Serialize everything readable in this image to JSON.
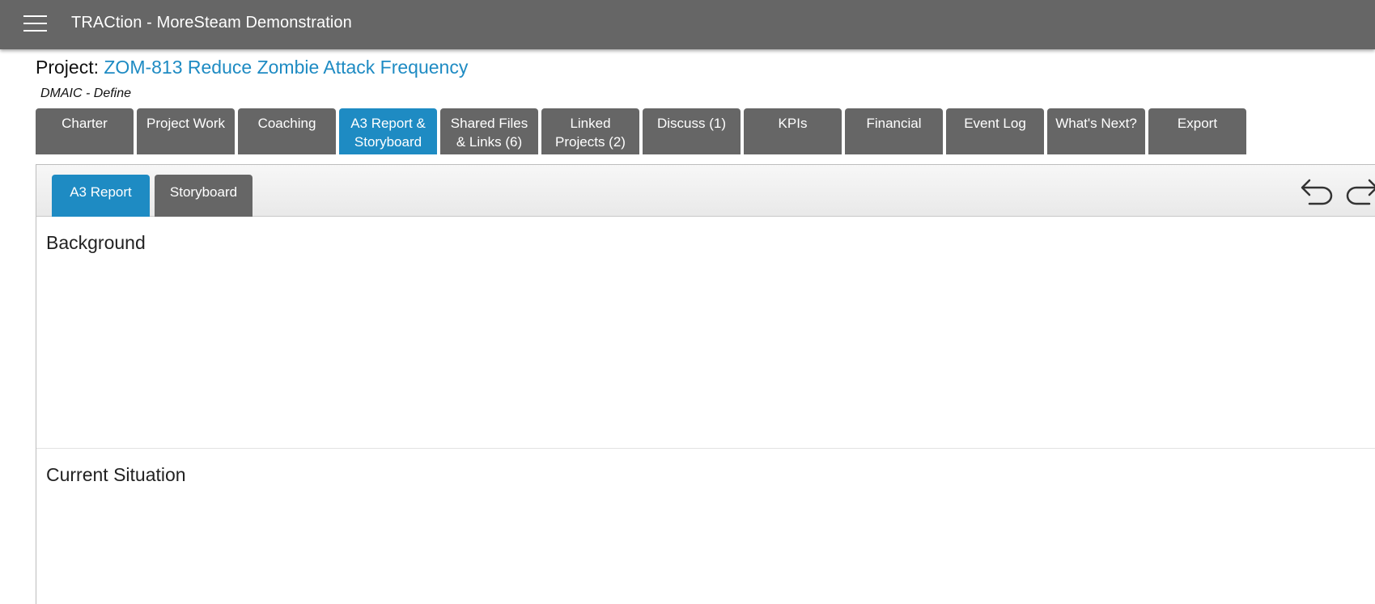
{
  "app": {
    "title": "TRACtion - MoreSteam Demonstration"
  },
  "project": {
    "prefix": "Project:",
    "name": "ZOM-813 Reduce Zombie Attack Frequency",
    "phase": "DMAIC - Define"
  },
  "main_tabs": [
    {
      "line1": "Charter",
      "line2": ""
    },
    {
      "line1": "Project Work",
      "line2": ""
    },
    {
      "line1": "Coaching",
      "line2": ""
    },
    {
      "line1": "A3 Report &",
      "line2": "Storyboard",
      "active": true
    },
    {
      "line1": "Shared Files",
      "line2": "& Links (6)"
    },
    {
      "line1": "Linked",
      "line2": "Projects (2)"
    },
    {
      "line1": "Discuss (1)",
      "line2": ""
    },
    {
      "line1": "KPIs",
      "line2": ""
    },
    {
      "line1": "Financial",
      "line2": ""
    },
    {
      "line1": "Event Log",
      "line2": ""
    },
    {
      "line1": "What's Next?",
      "line2": ""
    },
    {
      "line1": "Export",
      "line2": ""
    }
  ],
  "sub_tabs": [
    {
      "label": "A3 Report",
      "active": true
    },
    {
      "label": "Storyboard"
    }
  ],
  "toolbar": {
    "undo_icon": "undo-icon",
    "redo_icon": "redo-icon"
  },
  "sections": [
    {
      "title": "Background"
    },
    {
      "title": "Current Situation"
    }
  ],
  "colors": {
    "topbar": "#666666",
    "tab": "#666666",
    "accent": "#1e8bc3"
  }
}
